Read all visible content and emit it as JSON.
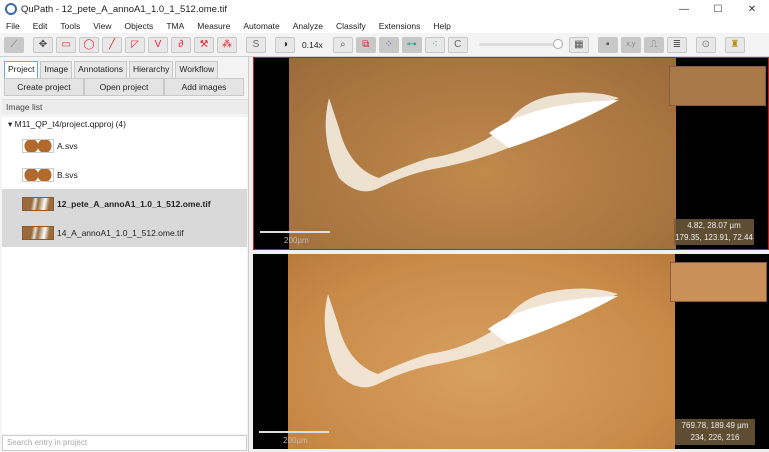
{
  "window": {
    "title": "QuPath - 12_pete_A_annoA1_1.0_1_512.ome.tif",
    "controls": [
      "—",
      "☐",
      "✕"
    ]
  },
  "menu": [
    "File",
    "Edit",
    "Tools",
    "View",
    "Objects",
    "TMA",
    "Measure",
    "Automate",
    "Analyze",
    "Classify",
    "Extensions",
    "Help"
  ],
  "toolbar": {
    "zoom": "0.14x",
    "tools": [
      "ruler-icon",
      "move-icon",
      "rectangle-icon",
      "ellipse-icon",
      "line-icon",
      "polygon-icon",
      "polyline-icon",
      "brush-icon",
      "wand-icon",
      "points-icon"
    ],
    "s_label": "S",
    "c_label": "C"
  },
  "tabs": [
    "Project",
    "Image",
    "Annotations",
    "Hierarchy",
    "Workflow"
  ],
  "buttons": {
    "create": "Create project",
    "open": "Open project",
    "add": "Add images"
  },
  "image_list": {
    "header": "Image list",
    "root": "▾ M11_QP_t4/project.qpproj (4)",
    "items": [
      {
        "name": "A.svs"
      },
      {
        "name": "B.svs"
      },
      {
        "name": "12_pete_A_annoA1_1.0_1_512.ome.tif"
      },
      {
        "name": "14_A_annoA1_1.0_1_512.ome.tif"
      }
    ]
  },
  "search_placeholder": "Search entry in project",
  "viewers": [
    {
      "readout1": "4.82, 28.07 µm",
      "readout2": "179.35, 123.91, 72.44",
      "scale": "200µm"
    },
    {
      "readout1": "769.78, 189.49 µm",
      "readout2": "234, 226, 216",
      "scale": "200µm"
    }
  ]
}
